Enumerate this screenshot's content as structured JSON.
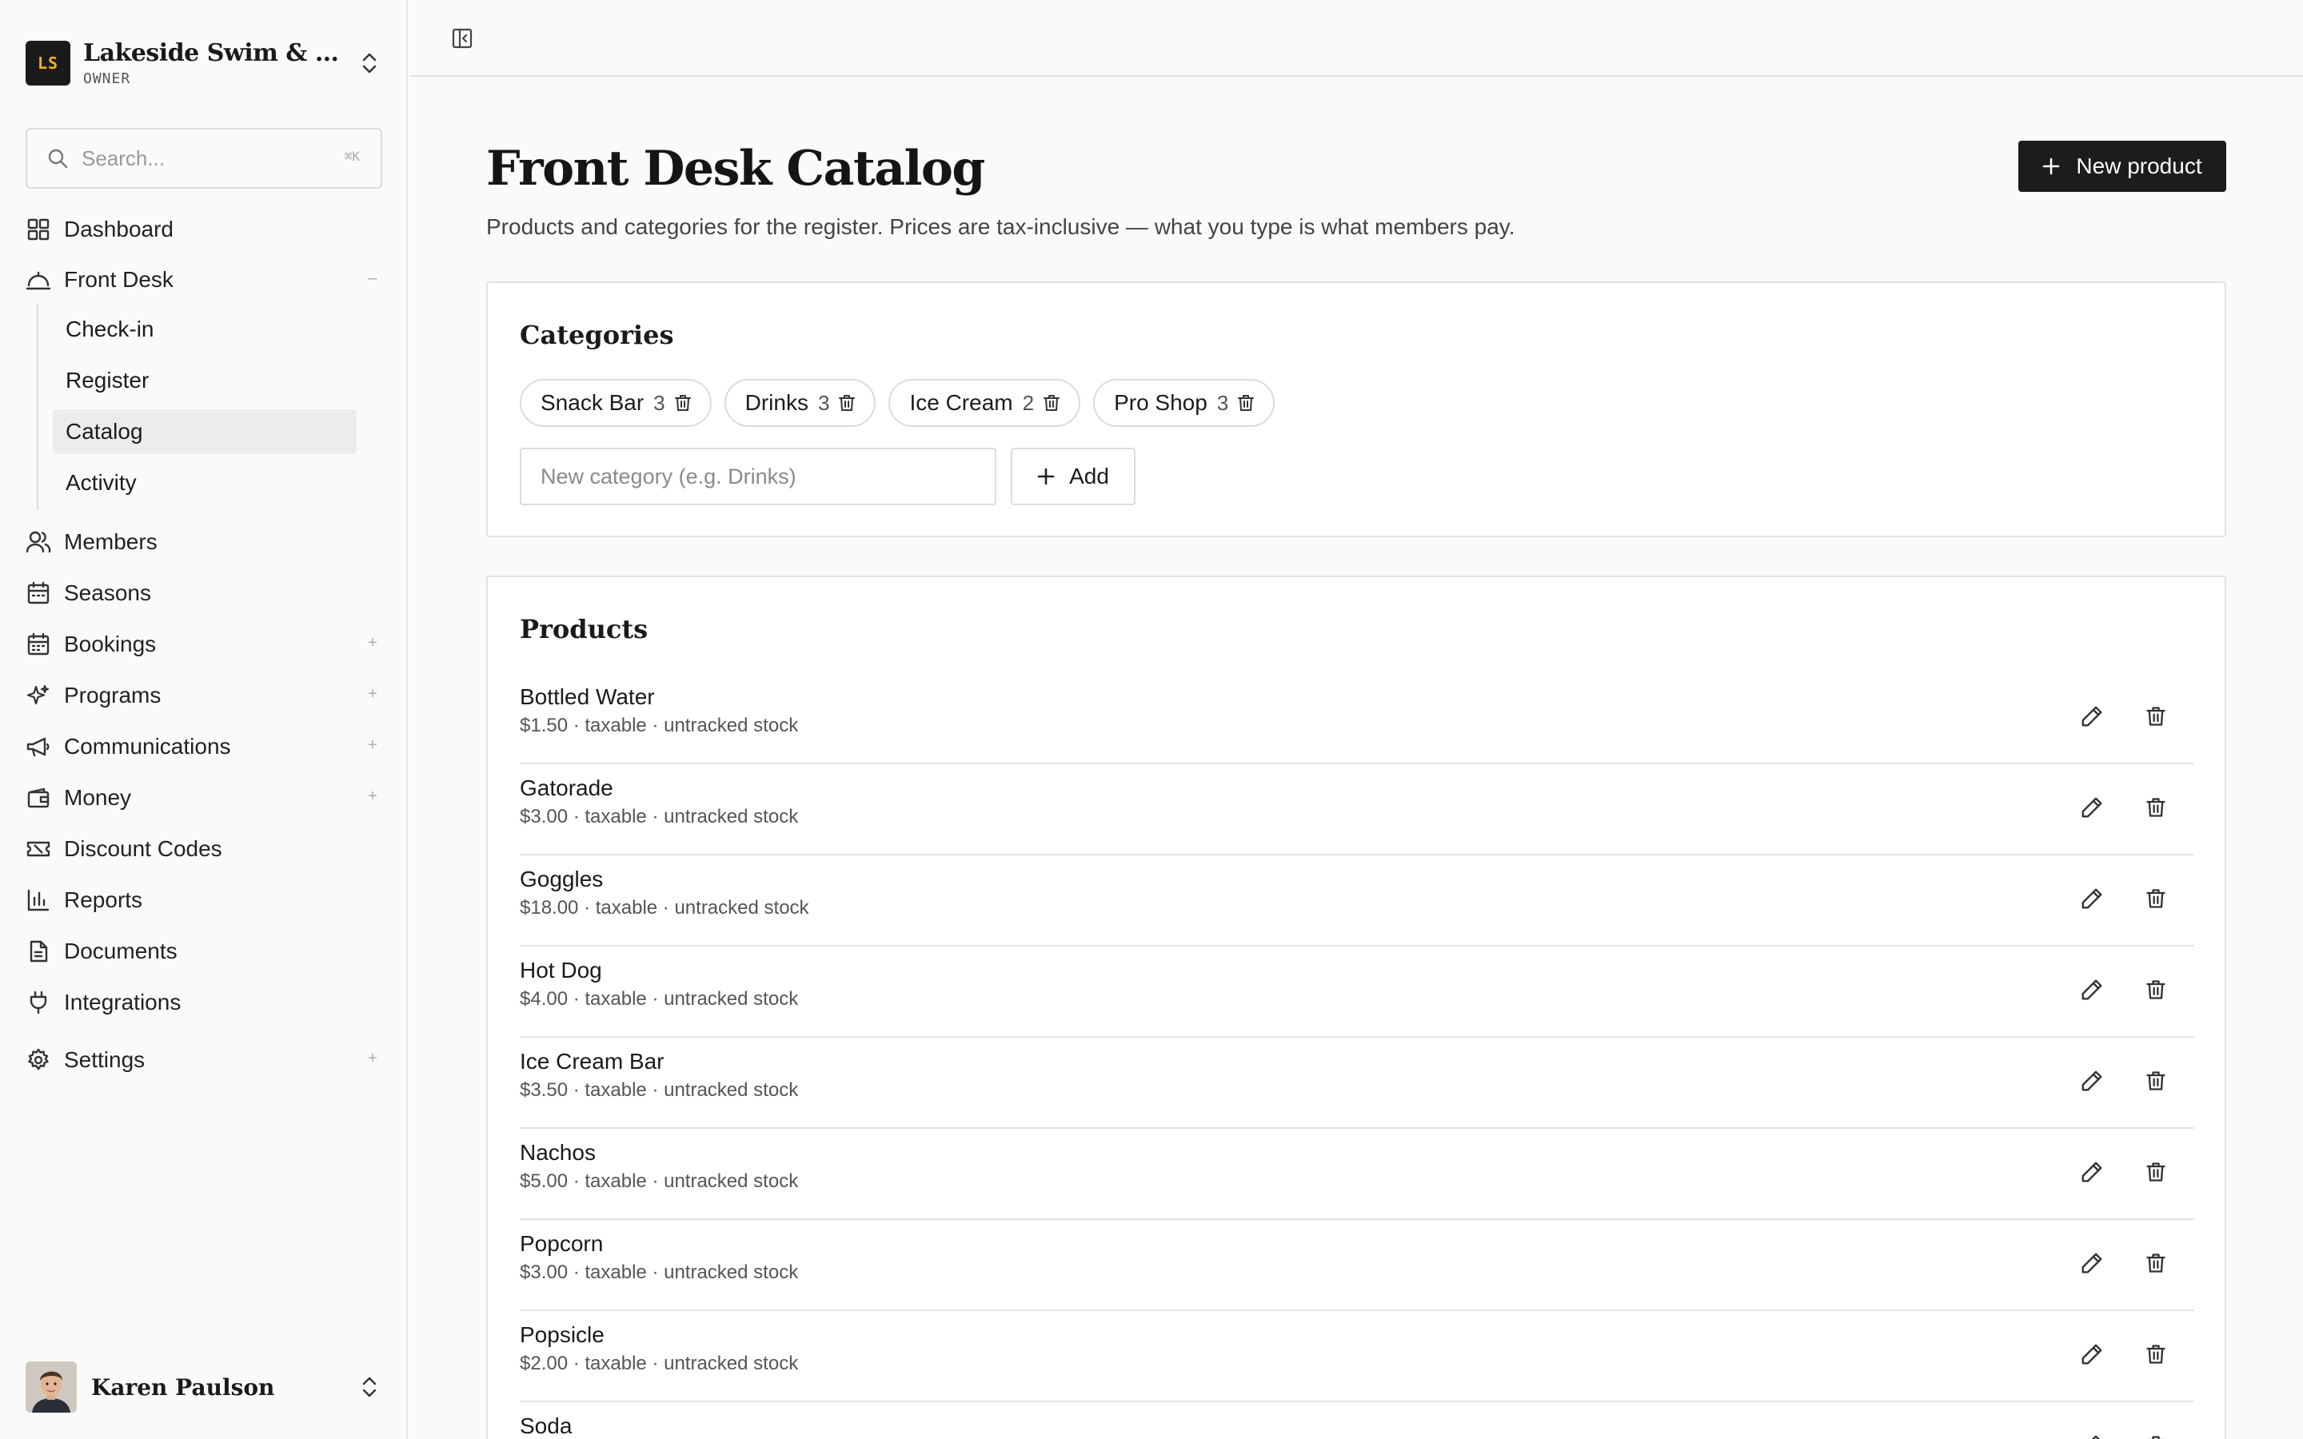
{
  "org": {
    "initials": "LS",
    "name": "Lakeside Swim & Tennis Club",
    "role": "OWNER"
  },
  "search": {
    "placeholder": "Search...",
    "shortcut": "⌘K"
  },
  "nav": {
    "dashboard": "Dashboard",
    "front_desk": "Front Desk",
    "front_desk_children": [
      "Check-in",
      "Register",
      "Catalog",
      "Activity"
    ],
    "members": "Members",
    "seasons": "Seasons",
    "bookings": "Bookings",
    "programs": "Programs",
    "communications": "Communications",
    "money": "Money",
    "discount_codes": "Discount Codes",
    "reports": "Reports",
    "documents": "Documents",
    "integrations": "Integrations",
    "settings": "Settings",
    "collapse_symbol": "–",
    "expand_symbol": "+"
  },
  "user": {
    "name": "Karen Paulson"
  },
  "page": {
    "title": "Front Desk Catalog",
    "subtitle": "Products and categories for the register. Prices are tax-inclusive — what you type is what members pay.",
    "new_product_label": "New product"
  },
  "categories": {
    "title": "Categories",
    "items": [
      {
        "name": "Snack Bar",
        "count": "3"
      },
      {
        "name": "Drinks",
        "count": "3"
      },
      {
        "name": "Ice Cream",
        "count": "2"
      },
      {
        "name": "Pro Shop",
        "count": "3"
      }
    ],
    "input_placeholder": "New category (e.g. Drinks)",
    "add_label": "Add"
  },
  "products": {
    "title": "Products",
    "items": [
      {
        "name": "Bottled Water",
        "meta": "$1.50 · taxable · untracked stock"
      },
      {
        "name": "Gatorade",
        "meta": "$3.00 · taxable · untracked stock"
      },
      {
        "name": "Goggles",
        "meta": "$18.00 · taxable · untracked stock"
      },
      {
        "name": "Hot Dog",
        "meta": "$4.00 · taxable · untracked stock"
      },
      {
        "name": "Ice Cream Bar",
        "meta": "$3.50 · taxable · untracked stock"
      },
      {
        "name": "Nachos",
        "meta": "$5.00 · taxable · untracked stock"
      },
      {
        "name": "Popcorn",
        "meta": "$3.00 · taxable · untracked stock"
      },
      {
        "name": "Popsicle",
        "meta": "$2.00 · taxable · untracked stock"
      },
      {
        "name": "Soda",
        "meta": ""
      }
    ]
  },
  "colors": {
    "accent": "#1c1c1c",
    "logo_text": "#f2b21c",
    "active_bg": "#ececec"
  }
}
